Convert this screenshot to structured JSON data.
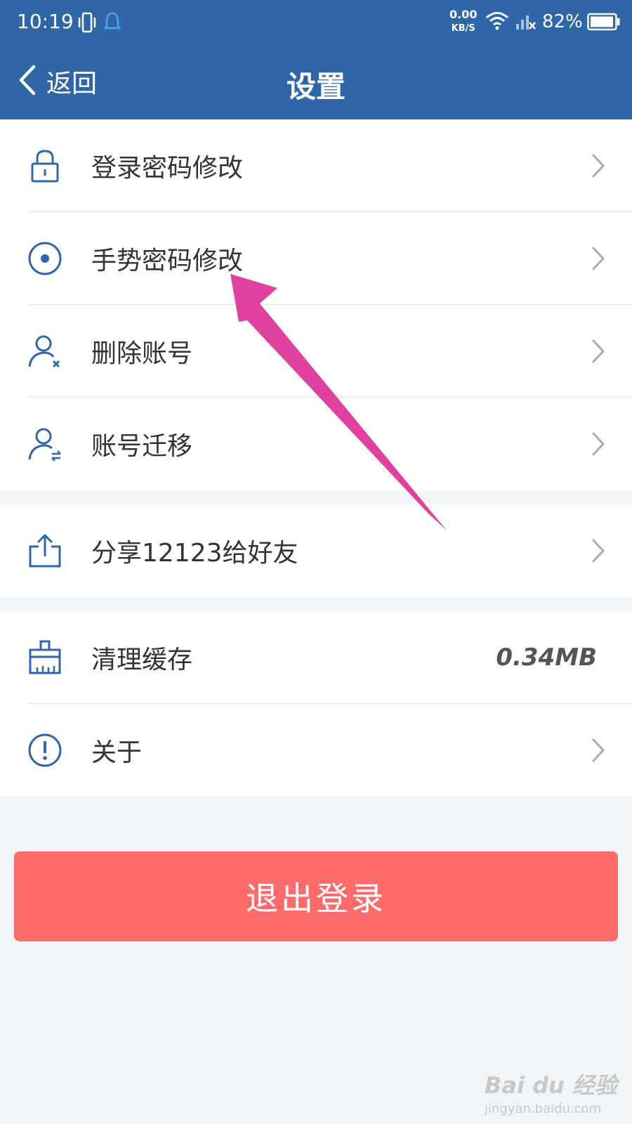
{
  "status_bar": {
    "time": "10:19",
    "net_speed_value": "0.00",
    "net_speed_unit": "KB/S",
    "battery": "82%"
  },
  "nav": {
    "back_label": "返回",
    "title": "设置"
  },
  "sections": {
    "account": [
      {
        "label": "登录密码修改",
        "icon": "lock-icon"
      },
      {
        "label": "手势密码修改",
        "icon": "gesture-icon"
      },
      {
        "label": "删除账号",
        "icon": "user-remove-icon"
      },
      {
        "label": "账号迁移",
        "icon": "user-transfer-icon"
      }
    ],
    "share": [
      {
        "label": "分享12123给好友",
        "icon": "share-icon"
      }
    ],
    "misc": [
      {
        "label": "清理缓存",
        "icon": "brush-icon",
        "value": "0.34MB"
      },
      {
        "label": "关于",
        "icon": "info-icon"
      }
    ]
  },
  "logout_label": "退出登录",
  "watermark": {
    "brand": "Bai du 经验",
    "url": "jingyan.baidu.com"
  },
  "colors": {
    "header": "#2e66a8",
    "icon": "#2e66a8",
    "logout": "#fe6b6b",
    "annotation_arrow": "#e040a0"
  }
}
